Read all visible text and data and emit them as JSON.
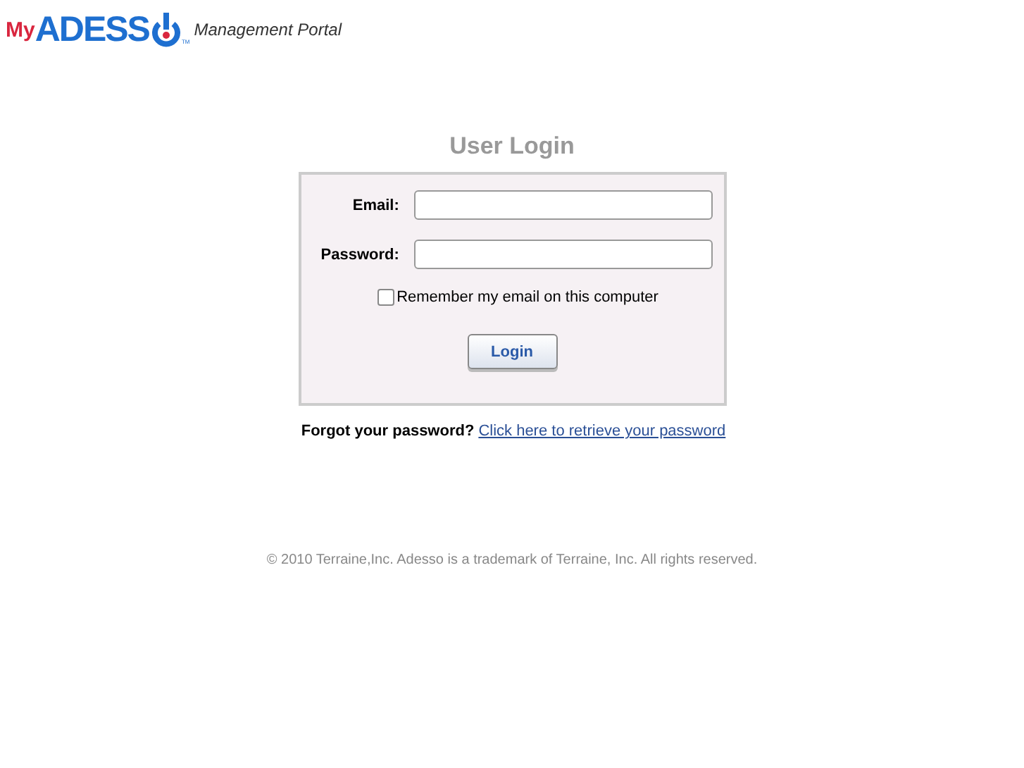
{
  "header": {
    "logo_prefix": "My",
    "logo_main": "ADESS",
    "logo_mark": "TM",
    "portal_name": "Management Portal"
  },
  "title": "User Login",
  "form": {
    "fields": [
      {
        "label": "Email:"
      },
      {
        "label": "Password:"
      }
    ],
    "remember": {
      "label": "Remember my email on this computer",
      "checked": false
    },
    "button": "Login"
  },
  "forgot": {
    "text": "Forgot your password?",
    "link": "Click here to retrieve your password"
  },
  "footer": "© 2010 Terraine,Inc. Adesso is a trademark of Terraine, Inc. All rights reserved."
}
